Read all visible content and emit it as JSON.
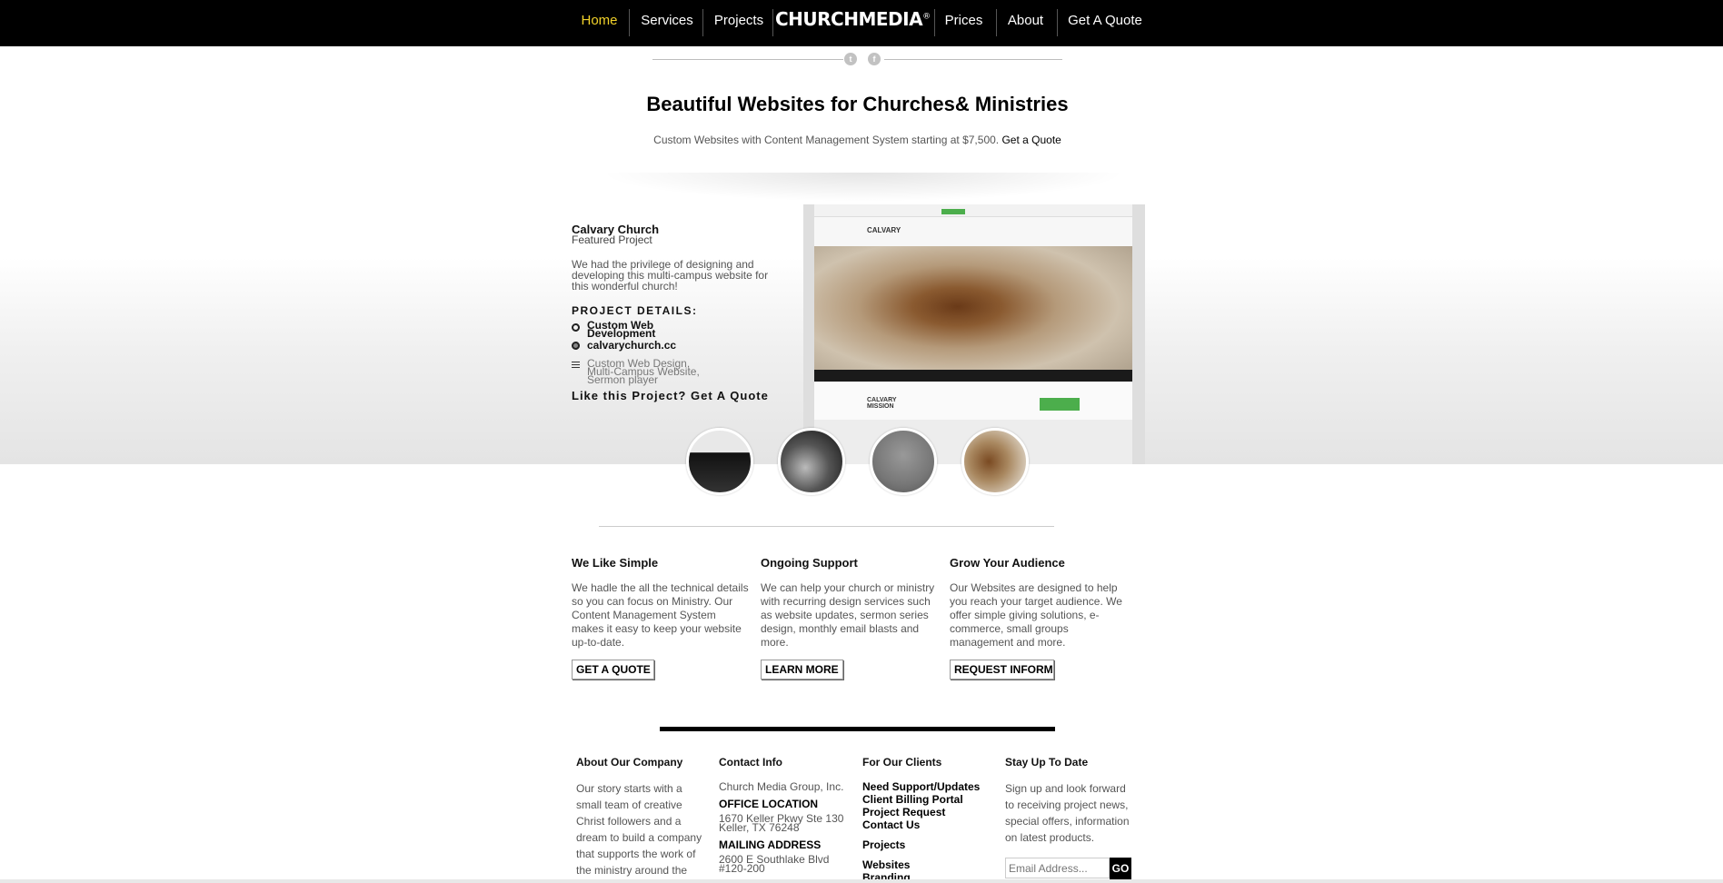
{
  "nav": {
    "items": [
      {
        "label": "Home",
        "active": true
      },
      {
        "label": "Services"
      },
      {
        "label": "Projects"
      },
      {
        "label": "Prices"
      },
      {
        "label": "About"
      },
      {
        "label": "Get A Quote"
      }
    ],
    "logo": "CHURCHMEDIA",
    "logo_mark": "®",
    "active_color": "#f2d22a",
    "social_icons": [
      "twitter-icon",
      "facebook-icon"
    ]
  },
  "hero": {
    "headline": "Beautiful Websites for Churches& Ministries",
    "subtitle": "Custom Websites with Content Management System starting at $7,500.",
    "subtitle_link": "Get a Quote"
  },
  "featured": {
    "title": "Calvary Church",
    "subtitle": "Featured Project",
    "description": "We had the privilege of designing and developing this multi-campus website for this wonderful church!",
    "details_heading": "PROJECT DETAILS:",
    "service": "Custom Web Development",
    "url": "calvarychurch.cc",
    "tags": "Custom Web Design, Multi-Campus Website, Sermon player",
    "cta": "Like this Project? Get A Quote",
    "mock_logo": "CALVARY",
    "mock_mission": "CALVARY MISSION"
  },
  "features": [
    {
      "title": "We Like Simple",
      "text": "We hadle the all the technical details so you can focus on Ministry. Our Content Management System makes it easy to keep your website up-to-date.",
      "button": "GET A QUOTE"
    },
    {
      "title": "Ongoing Support",
      "text": "We can help your church or ministry with recurring design services such as website updates, sermon series design, monthly email blasts and more.",
      "button": "LEARN MORE"
    },
    {
      "title": "Grow Your Audience",
      "text": "Our Websites are designed to help you reach your target audience. We offer simple giving solutions, e-commerce, small groups management and more.",
      "button": "REQUEST INFORMATION"
    }
  ],
  "footer": {
    "about": {
      "title": "About Our Company",
      "text": "Our story starts with a small team of creative Christ followers and a dream to build a company that supports the work of the ministry around the"
    },
    "contact": {
      "title": "Contact Info",
      "company": "Church Media Group, Inc.",
      "office_label": "OFFICE LOCATION",
      "office_line1": "1670 Keller Pkwy Ste 130",
      "office_line2": "Keller, TX 76248",
      "mailing_label": "MAILING ADDRESS",
      "mailing_line1": "2600 E Southlake Blvd",
      "mailing_line2": "#120-200"
    },
    "clients": {
      "title": "For Our Clients",
      "links": [
        "Need Support/Updates",
        "Client Billing Portal",
        "Project Request",
        "Contact Us"
      ],
      "projects": "Projects",
      "project_links": [
        "Websites",
        "Branding"
      ]
    },
    "newsletter": {
      "title": "Stay Up To Date",
      "text": "Sign up and look forward to receiving project news, special offers, information on latest products.",
      "placeholder": "Email Address...",
      "button": "GO"
    }
  }
}
